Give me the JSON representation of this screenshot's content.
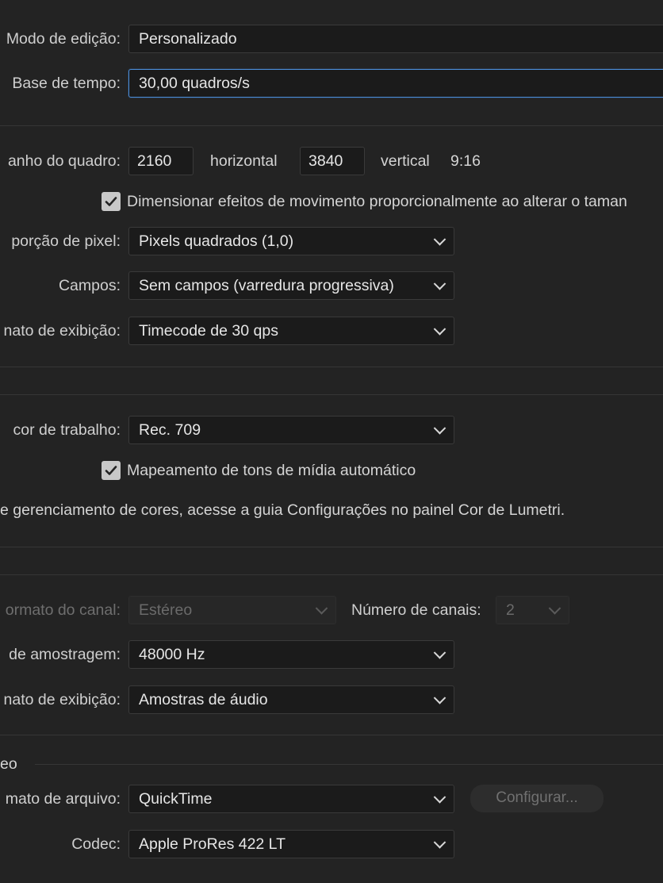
{
  "video": {
    "editing_mode": {
      "label": "Modo de edição:",
      "value": "Personalizado"
    },
    "timebase": {
      "label": "Base de tempo:",
      "value": "30,00  quadros/s"
    },
    "frame_size": {
      "label": "anho do quadro:",
      "horizontal_value": "2160",
      "horizontal_label": "horizontal",
      "vertical_value": "3840",
      "vertical_label": "vertical",
      "aspect": "9:16"
    },
    "scale_motion": {
      "label": "Dimensionar efeitos de movimento proporcionalmente ao alterar o taman",
      "checked": true
    },
    "pixel_aspect": {
      "label": "porção de pixel:",
      "value": "Pixels quadrados (1,0)"
    },
    "fields": {
      "label": "Campos:",
      "value": "Sem campos (varredura progressiva)"
    },
    "display_format": {
      "label": "nato de exibição:",
      "value": "Timecode de 30 qps"
    }
  },
  "color": {
    "working_space": {
      "label": "cor de trabalho:",
      "value": "Rec. 709"
    },
    "auto_tone_map": {
      "label": "Mapeamento de tons de mídia automático",
      "checked": true
    },
    "info": "e gerenciamento de cores, acesse a guia Configurações no painel Cor de Lumetri."
  },
  "audio": {
    "channel_format": {
      "label": "ormato do canal:",
      "value": "Estéreo",
      "disabled": true
    },
    "channel_count": {
      "label": "Número de canais:",
      "value": "2",
      "disabled": true
    },
    "sample_rate": {
      "label": "de amostragem:",
      "value": "48000 Hz"
    },
    "display_format": {
      "label": "nato de exibição:",
      "value": "Amostras de áudio"
    }
  },
  "preview": {
    "section_title": "eo",
    "file_format": {
      "label": "mato de arquivo:",
      "value": "QuickTime"
    },
    "configure_button": "Configurar...",
    "codec": {
      "label": "Codec:",
      "value": "Apple ProRes 422 LT"
    }
  },
  "colors": {
    "background": "#232323",
    "field": "#1b1b1b",
    "focus": "#4c8edb",
    "divider": "#363636"
  }
}
